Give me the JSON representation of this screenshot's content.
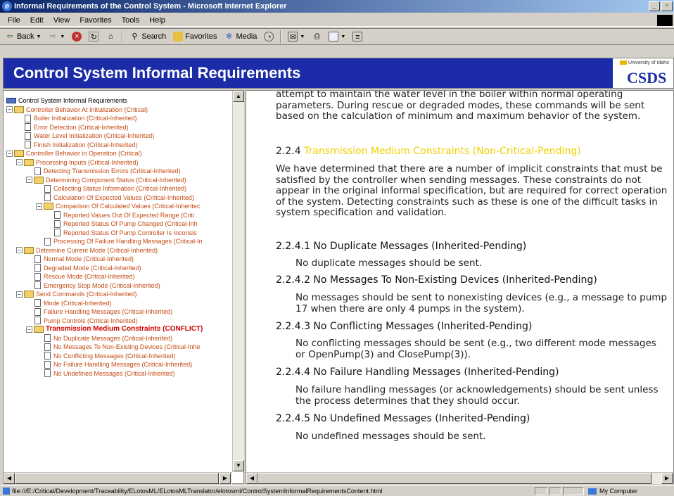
{
  "window": {
    "title": "Informal Requirements of the Control System - Microsoft Internet Explorer"
  },
  "menu": [
    "File",
    "Edit",
    "View",
    "Favorites",
    "Tools",
    "Help"
  ],
  "toolbar": {
    "back": "Back",
    "search": "Search",
    "favorites": "Favorites",
    "media": "Media"
  },
  "banner": {
    "title": "Control System Informal Requirements",
    "university": "University of Idaho",
    "logo": "CSDS"
  },
  "tree": {
    "nodes": [
      {
        "label": "Control System Informal Requirements",
        "level": 0,
        "kind": "root",
        "style": "root"
      },
      {
        "label": "Controller Behavior At Initialization (Critical)",
        "level": 0,
        "kind": "folder",
        "expanded": true
      },
      {
        "label": "Boiler Initialization (Critical-Inherited)",
        "level": 1,
        "kind": "doc"
      },
      {
        "label": "Error Detection (Critical-Inherited)",
        "level": 1,
        "kind": "doc"
      },
      {
        "label": "Water Level Initialization (Critical-Inherited)",
        "level": 1,
        "kind": "doc"
      },
      {
        "label": "Finish Initialization (Critical-Inherited)",
        "level": 1,
        "kind": "doc"
      },
      {
        "label": "Controller Behavior in Operation (Critical)",
        "level": 0,
        "kind": "folder",
        "expanded": true
      },
      {
        "label": "Processing Inputs (Critical-Inherited)",
        "level": 1,
        "kind": "folder",
        "expanded": true
      },
      {
        "label": "Detecting Transmission Errors (Critical-Inherited)",
        "level": 2,
        "kind": "doc"
      },
      {
        "label": "Determining Component Status (Critical-Inherited)",
        "level": 2,
        "kind": "folder",
        "expanded": true
      },
      {
        "label": "Collecting Status Information (Critical-Inherited)",
        "level": 3,
        "kind": "doc"
      },
      {
        "label": "Calculation Of Expected Values (Critical-Inherited)",
        "level": 3,
        "kind": "doc"
      },
      {
        "label": "Comparison Of Calculated Values (Critical-Inheritec",
        "level": 3,
        "kind": "folder",
        "expanded": true
      },
      {
        "label": "Reported Values Out Of Expected Range (Criti",
        "level": 4,
        "kind": "doc"
      },
      {
        "label": "Reported Status Of Pump Changed (Critical-Inh",
        "level": 4,
        "kind": "doc"
      },
      {
        "label": "Reported Status Of Pump Controller Is Inconsis",
        "level": 4,
        "kind": "doc"
      },
      {
        "label": "Processing Of Failure Handling Messages (Critical-In",
        "level": 3,
        "kind": "doc"
      },
      {
        "label": "Determine Current Mode (Critical-Inherited)",
        "level": 1,
        "kind": "folder",
        "expanded": true
      },
      {
        "label": "Normal Mode (Critical-Inherited)",
        "level": 2,
        "kind": "doc"
      },
      {
        "label": "Degraded Mode (Critical-Inherited)",
        "level": 2,
        "kind": "doc"
      },
      {
        "label": "Rescue Mode (Critical-Inherited)",
        "level": 2,
        "kind": "doc"
      },
      {
        "label": "Emergency Stop Mode (Critical-Inherited)",
        "level": 2,
        "kind": "doc"
      },
      {
        "label": "Send Commands (Critical-Inherited)",
        "level": 1,
        "kind": "folder",
        "expanded": true
      },
      {
        "label": "Mode (Critical-Inherited)",
        "level": 2,
        "kind": "doc"
      },
      {
        "label": "Failure Handling Messages (Critical-Inherited)",
        "level": 2,
        "kind": "doc"
      },
      {
        "label": "Pump Controls (Critical-Inherited)",
        "level": 2,
        "kind": "doc"
      },
      {
        "label": "Transmission Medium Constraints (CONFLICT)",
        "level": 2,
        "kind": "folder",
        "expanded": true,
        "style": "conflict"
      },
      {
        "label": "No Duplicate Messages (Critical-Inherited)",
        "level": 3,
        "kind": "doc"
      },
      {
        "label": "No Messages To Non-Existing Devices (Critical-Inhe",
        "level": 3,
        "kind": "doc"
      },
      {
        "label": "No Conflicting Messages (Critical-Inherited)",
        "level": 3,
        "kind": "doc"
      },
      {
        "label": "No Failure Handling Messages (Critical-Inherited)",
        "level": 3,
        "kind": "doc"
      },
      {
        "label": "No Undefined Messages (Critical-Inherited)",
        "level": 3,
        "kind": "doc"
      }
    ]
  },
  "content": {
    "intro": "attempt to maintain the water level in the boiler within normal operating parameters. During rescue or degraded modes, these commands will be sent based on the calculation of minimum and maximum behavior of the system.",
    "section_num": "2.2.4",
    "section_title": "Transmission Medium Constraints (Non-Critical-Pending)",
    "section_body": "We have determined that there are a number of implicit constraints that must be satisfied by the controller when sending messages. These constraints do not appear in the original informal specification, but are required for correct operation of the system. Detecting constraints such as these is one of the difficult tasks in system specification and validation.",
    "subsections": [
      {
        "heading": "2.2.4.1 No Duplicate Messages (Inherited-Pending)",
        "body": "No duplicate messages should be sent."
      },
      {
        "heading": "2.2.4.2 No Messages To Non-Existing Devices (Inherited-Pending)",
        "body": "No messages should be sent to nonexisting devices (e.g., a message to pump 17 when there are only 4 pumps in the system)."
      },
      {
        "heading": "2.2.4.3 No Conflicting Messages (Inherited-Pending)",
        "body": "No conflicting messages should be sent (e.g., two different mode messages or OpenPump(3) and ClosePump(3))."
      },
      {
        "heading": "2.2.4.4 No Failure Handling Messages (Inherited-Pending)",
        "body": "No failure handling messages (or acknowledgements) should be sent unless the process determines that they should occur."
      },
      {
        "heading": "2.2.4.5 No Undefined Messages (Inherited-Pending)",
        "body": "No undefined messages should be sent."
      }
    ]
  },
  "statusbar": {
    "url": "file:///E:/Critical/Development/Traceability/ELotosML/ELotosMLTranslator/elotosml/ControlSystemInformalRequirementsContent.html",
    "zone": "My Computer"
  }
}
